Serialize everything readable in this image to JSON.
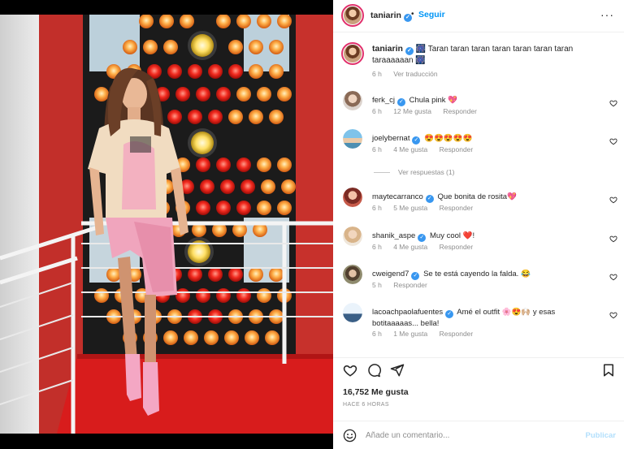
{
  "post": {
    "username": "taniarin",
    "follow_separator": "•",
    "follow_label": "Seguir",
    "more_label": "···"
  },
  "caption": {
    "username": "taniarin",
    "text": "🎆 Taran taran taran taran taran taran taran taraaaaaan 🎆",
    "time": "6 h",
    "translate_label": "Ver traducción"
  },
  "comments": [
    {
      "username": "ferk_cj",
      "text": "Chula pink 💖",
      "time": "6 h",
      "likes": "12 Me gusta",
      "reply": "Responder"
    },
    {
      "username": "joelybernat",
      "text": "😍😍😍😍😍",
      "time": "6 h",
      "likes": "4 Me gusta",
      "reply": "Responder"
    },
    {
      "username": "maytecarranco",
      "text": "Que bonita de rosita💖",
      "time": "6 h",
      "likes": "5 Me gusta",
      "reply": "Responder"
    },
    {
      "username": "shanik_aspe",
      "text": "Muy cool ❤️!",
      "time": "6 h",
      "likes": "4 Me gusta",
      "reply": "Responder"
    },
    {
      "username": "cweigend7",
      "text": "Se te está cayendo la falda. 😂",
      "time": "5 h",
      "likes": "",
      "reply": "Responder"
    },
    {
      "username": "lacoachpaolafuentes",
      "text": "Amé el outfit 🌸😍🙌🏼 y esas botitaaaaas... bella!",
      "time": "6 h",
      "likes": "1 Me gusta",
      "reply": "Responder"
    }
  ],
  "replies_label": "Ver respuestas (1)",
  "likes_count": "16,752 Me gusta",
  "posted_ago": "HACE 6 HORAS",
  "comment_input": {
    "placeholder": "Añade un comentario...",
    "publish_label": "Publicar"
  },
  "colors": {
    "accent": "#0095f6",
    "verified": "#3897f0",
    "muted": "#8e8e8e",
    "publish_disabled": "#b2dffc"
  }
}
